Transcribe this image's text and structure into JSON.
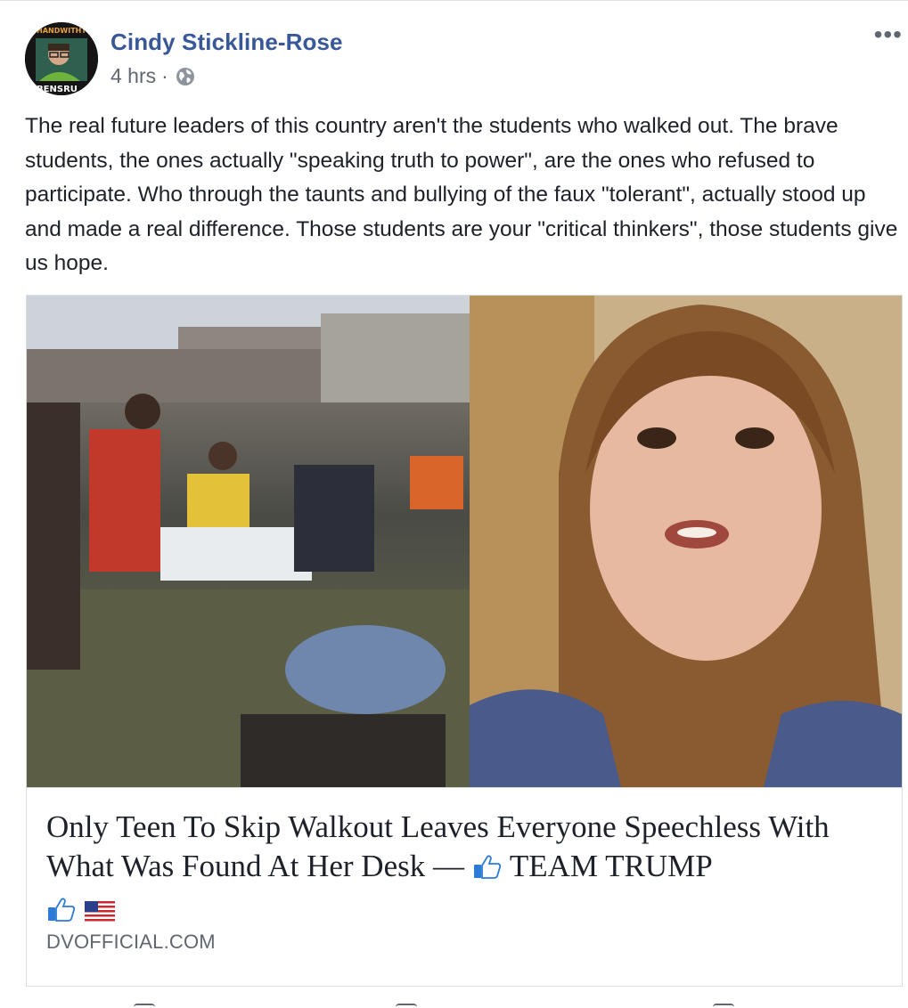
{
  "post": {
    "author": "Cindy Stickline-Rose",
    "timestamp": "4 hrs",
    "separator": "·",
    "visibility_icon": "globe-icon",
    "more_label": "•••",
    "avatar_text_top": "HANDWITHT",
    "avatar_text_bottom": "BENSRU",
    "text": "The real future leaders of this country aren't the students who walked out. The brave students, the ones actually \"speaking truth to power\", are the ones who refused to participate. Who through the taunts and bullying of the faux \"tolerant\", actually stood up and made a real difference. Those students are your \"critical thinkers\", those students give us hope."
  },
  "link_card": {
    "title_part1": "Only Teen To Skip Walkout Leaves Everyone Speechless With What Was Found At Her Desk —",
    "title_part2": "TEAM TRUMP",
    "emojis": [
      "thumbs-up-icon",
      "thumbs-up-icon",
      "us-flag-icon"
    ],
    "domain": "DVOFFICIAL.COM"
  },
  "colors": {
    "author": "#385898",
    "text": "#1d2129",
    "meta": "#616770",
    "border": "#dadde1"
  }
}
